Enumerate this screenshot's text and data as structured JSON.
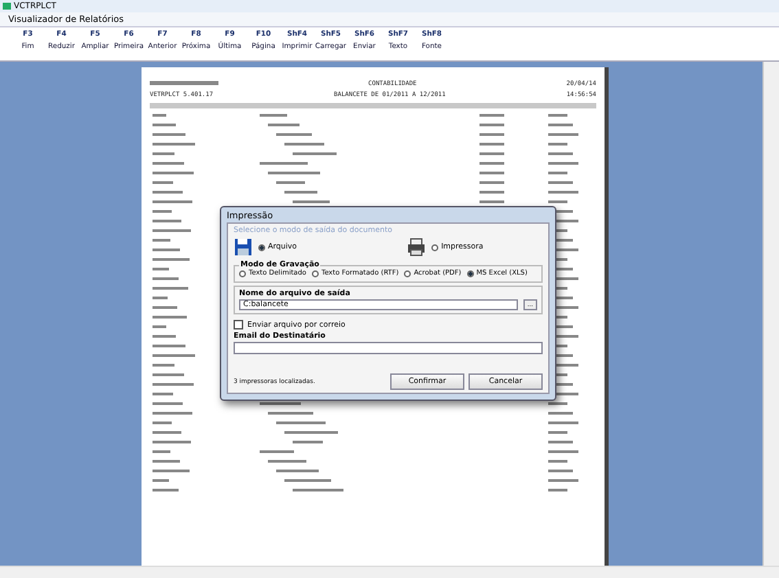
{
  "app_title": "VCTRPLCT",
  "window": {
    "title": "Visualizador de Relatórios"
  },
  "toolbar": [
    {
      "key": "F3",
      "label": "Fim"
    },
    {
      "key": "F4",
      "label": "Reduzir"
    },
    {
      "key": "F5",
      "label": "Ampliar"
    },
    {
      "key": "F6",
      "label": "Primeira"
    },
    {
      "key": "F7",
      "label": "Anterior"
    },
    {
      "key": "F8",
      "label": "Próxima"
    },
    {
      "key": "F9",
      "label": "Última"
    },
    {
      "key": "F10",
      "label": "Página"
    },
    {
      "key": "ShF4",
      "label": "Imprimir"
    },
    {
      "key": "ShF5",
      "label": "Carregar"
    },
    {
      "key": "ShF6",
      "label": "Enviar"
    },
    {
      "key": "ShF7",
      "label": "Texto"
    },
    {
      "key": "ShF8",
      "label": "Fonte"
    }
  ],
  "report": {
    "header_center": "CONTABILIDADE",
    "date": "20/04/14",
    "program": "VETRPLCT 5.401.17",
    "subtitle": "BALANCETE DE 01/2011 A 12/2011",
    "time": "14:56:54"
  },
  "dialog": {
    "title": "Impressão",
    "prompt": "Selecione o modo de saída do documento",
    "outputs": [
      {
        "kind": "file",
        "label": "Arquivo",
        "selected": true
      },
      {
        "kind": "printer",
        "label": "Impressora",
        "selected": false
      }
    ],
    "format_group": "Modo de Gravação",
    "formats": [
      {
        "label": "Texto Delimitado",
        "selected": false
      },
      {
        "label": "Texto Formatado (RTF)",
        "selected": false
      },
      {
        "label": "Acrobat (PDF)",
        "selected": false
      },
      {
        "label": "MS Excel (XLS)",
        "selected": true
      }
    ],
    "file_label": "Nome do arquivo de saída",
    "file_value": "C:balancete",
    "browse": "...",
    "mail_checkbox": {
      "label": "Enviar arquivo por correio",
      "checked": false
    },
    "email_label": "Email do Destinatário",
    "status": "3 impressoras localizadas.",
    "buttons": [
      "Confirmar",
      "Cancelar"
    ]
  }
}
